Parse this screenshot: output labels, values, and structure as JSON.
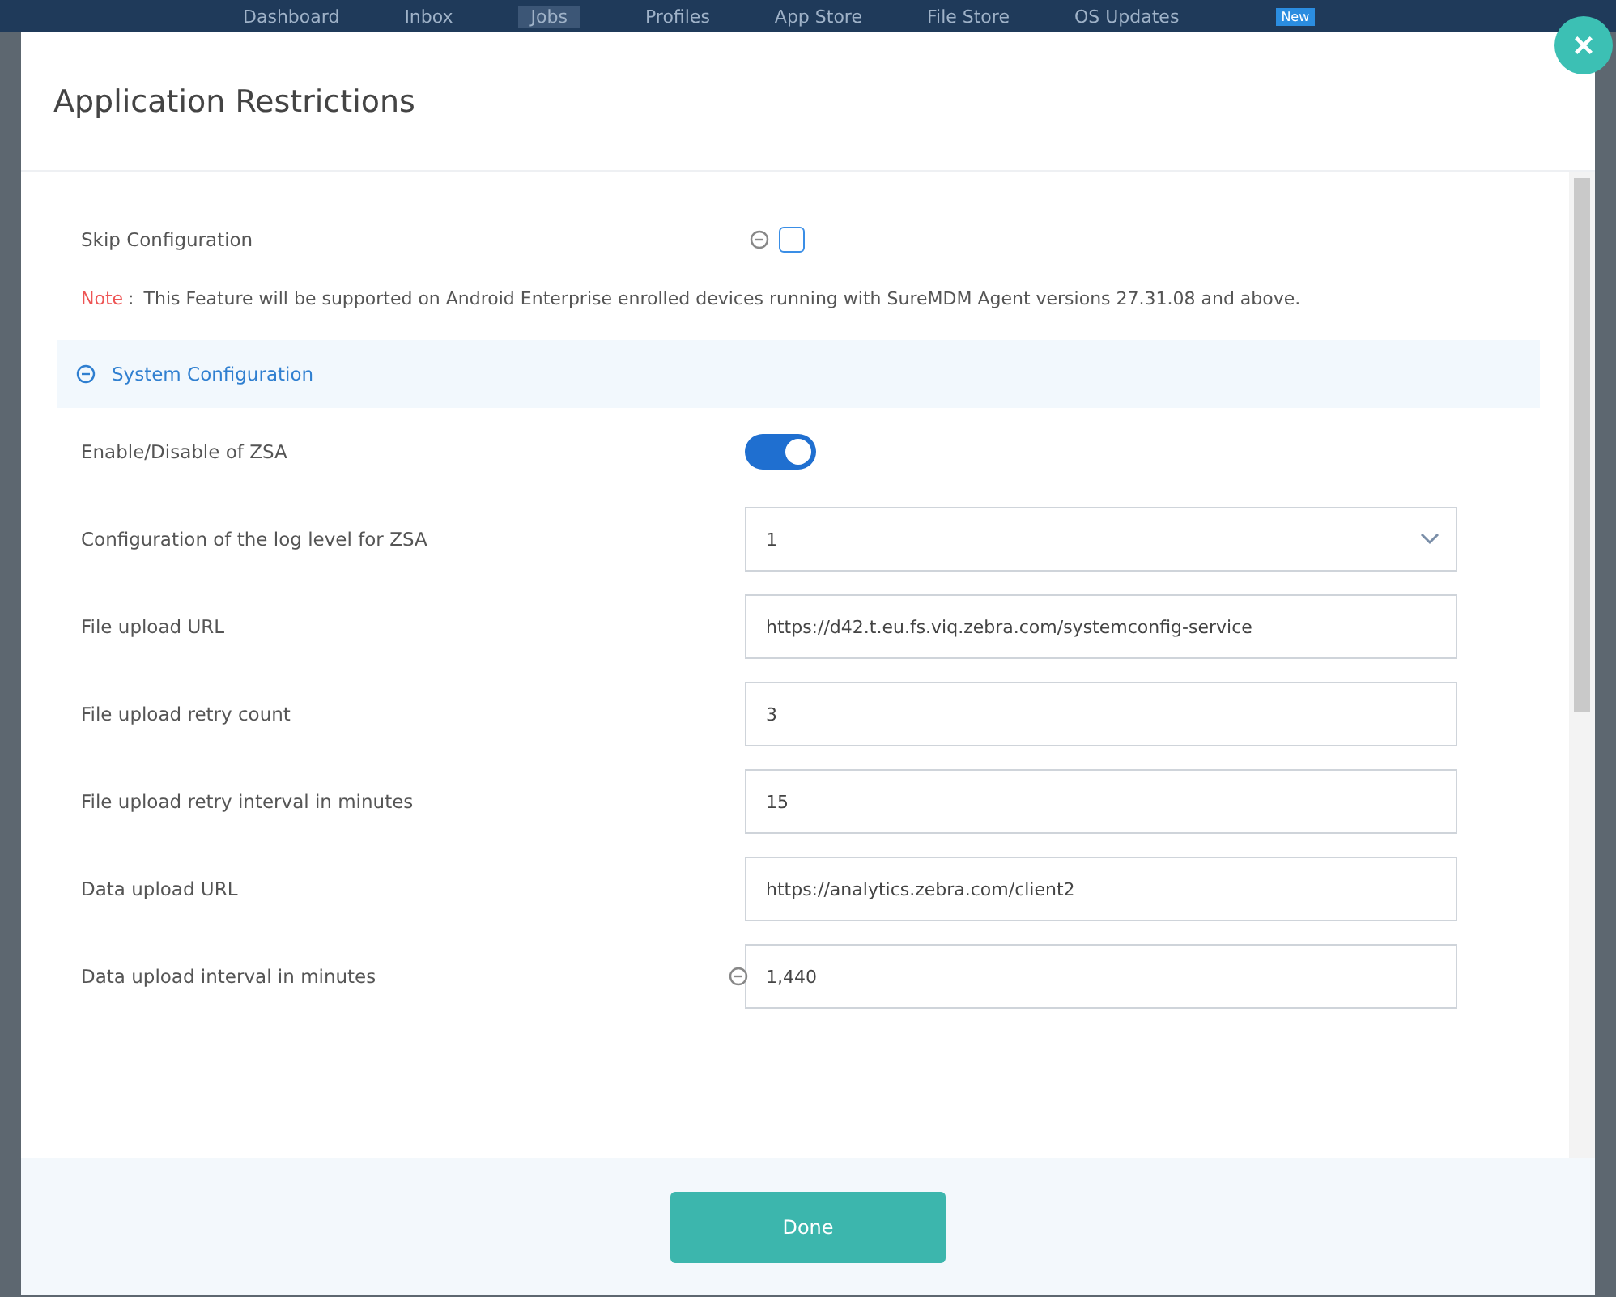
{
  "nav": {
    "items": [
      {
        "label": "Dashboard",
        "selected": false
      },
      {
        "label": "Inbox",
        "selected": false
      },
      {
        "label": "Jobs",
        "selected": true
      },
      {
        "label": "Profiles",
        "selected": false
      },
      {
        "label": "App Store",
        "selected": false
      },
      {
        "label": "File Store",
        "selected": false
      },
      {
        "label": "OS Updates",
        "selected": false
      }
    ],
    "badge": "New"
  },
  "dialog": {
    "title": "Application Restrictions",
    "skip": {
      "label": "Skip Configuration",
      "checked": false
    },
    "note": {
      "tag": "Note",
      "separator": ":",
      "text": "This Feature will be supported on Android Enterprise enrolled devices running with SureMDM Agent versions 27.31.08 and above."
    },
    "section": {
      "title": "System Configuration",
      "expanded": true
    },
    "fields": [
      {
        "kind": "toggle",
        "label": "Enable/Disable of ZSA",
        "on": true
      },
      {
        "kind": "select",
        "label": "Configuration of the log level for ZSA",
        "value": "1"
      },
      {
        "kind": "text",
        "label": "File upload URL",
        "value": "https://d42.t.eu.fs.viq.zebra.com/systemconfig-service"
      },
      {
        "kind": "text",
        "label": "File upload retry count",
        "value": "3"
      },
      {
        "kind": "text",
        "label": "File upload retry interval in minutes",
        "value": "15"
      },
      {
        "kind": "text",
        "label": "Data upload URL",
        "value": "https://analytics.zebra.com/client2"
      },
      {
        "kind": "text",
        "label": "Data upload interval in minutes",
        "value": "1,440",
        "info": true
      }
    ],
    "done": "Done"
  }
}
